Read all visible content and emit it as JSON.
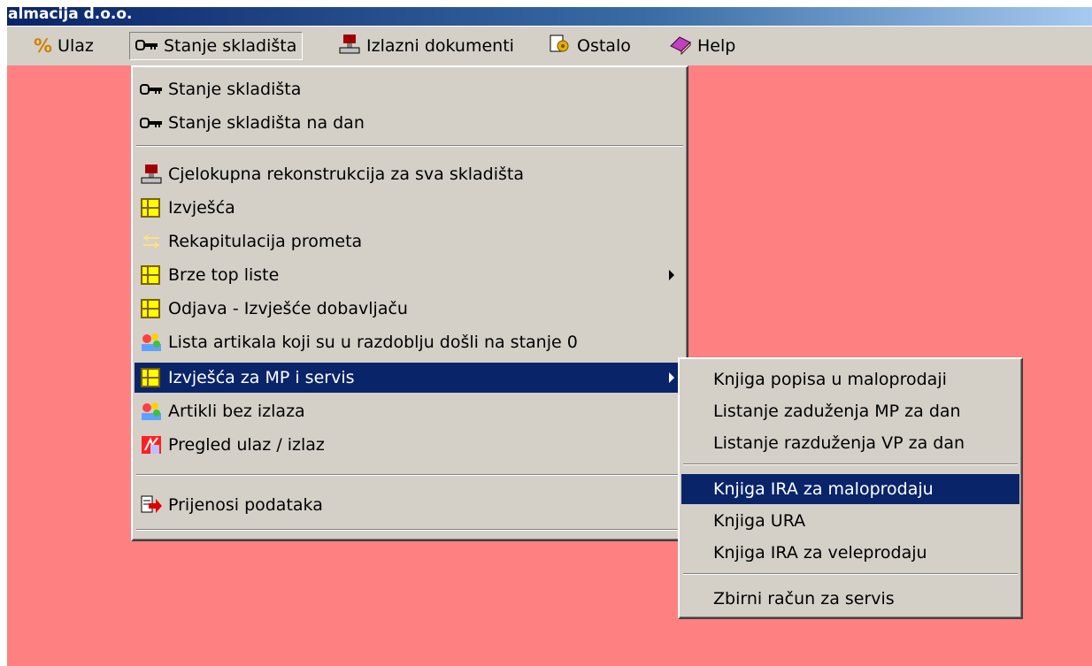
{
  "window": {
    "title": "almacija d.o.o."
  },
  "menubar": {
    "items": [
      {
        "label": "Ulaz",
        "icon": "percent-icon"
      },
      {
        "label": "Stanje skladišta",
        "icon": "key-icon"
      },
      {
        "label": "Izlazni dokumenti",
        "icon": "stamp-icon"
      },
      {
        "label": "Ostalo",
        "icon": "tools-icon"
      },
      {
        "label": "Help",
        "icon": "book-icon"
      }
    ]
  },
  "stanje_menu": {
    "items": [
      {
        "label": "Stanje skladišta",
        "icon": "key-icon"
      },
      {
        "label": "Stanje skladišta na dan",
        "icon": "key-icon"
      },
      {
        "label": "Cjelokupna rekonstrukcija za sva skladišta",
        "icon": "stamp-icon"
      },
      {
        "label": "Izvješća",
        "icon": "report-icon"
      },
      {
        "label": "Rekapitulacija prometa",
        "icon": "recap-icon"
      },
      {
        "label": "Brze top liste",
        "icon": "report-icon",
        "submenu": true
      },
      {
        "label": "Odjava - Izvješće dobavljaču",
        "icon": "report-icon"
      },
      {
        "label": "Lista artikala koji su u razdoblju došli na stanje 0",
        "icon": "articles-icon"
      },
      {
        "label": "Izvješća za MP i servis",
        "icon": "report-icon",
        "submenu": true,
        "highlighted": true
      },
      {
        "label": "Artikli bez izlaza",
        "icon": "articles-icon"
      },
      {
        "label": "Pregled ulaz / izlaz",
        "icon": "inout-icon"
      },
      {
        "label": "Prijenosi podataka",
        "icon": "transfer-icon"
      }
    ]
  },
  "mp_submenu": {
    "items": [
      {
        "label": "Knjiga popisa u maloprodaji"
      },
      {
        "label": "Listanje zaduženja MP za dan"
      },
      {
        "label": "Listanje razduženja VP za dan"
      },
      {
        "label": "Knjiga IRA za maloprodaju",
        "highlighted": true
      },
      {
        "label": "Knjiga URA"
      },
      {
        "label": "Knjiga IRA za veleprodaju"
      },
      {
        "label": "Zbirni račun za servis"
      }
    ]
  },
  "colors": {
    "workarea": "#ff8080",
    "menu_face": "#d4d0c8",
    "highlight": "#0a246a",
    "titlebar": "#0a246a"
  }
}
